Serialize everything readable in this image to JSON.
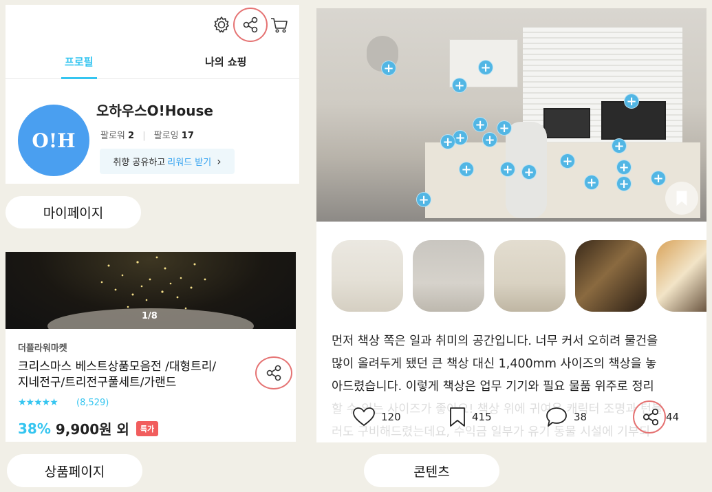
{
  "profile": {
    "tabs": [
      "프로필",
      "나의 쇼핑"
    ],
    "avatar_text": "O!H",
    "name": "오하우스O!House",
    "followers_label": "팔로워",
    "followers_count": "2",
    "following_label": "팔로잉",
    "following_count": "17",
    "reward_prefix": "취향 공유하고",
    "reward_link": "리워드 받기",
    "reward_chevron": "›",
    "icons": [
      "gear-icon",
      "share-icon",
      "cart-icon"
    ],
    "caption": "마이페이지"
  },
  "product": {
    "counter": "1/8",
    "seller": "더플라워마켓",
    "title_line1": "크리스마스 베스트상품모음전 /대형트리/",
    "title_line2": "지네전구/트리전구풀세트/가랜드",
    "stars": "★★★★★",
    "review_count": "(8,529)",
    "discount": "38%",
    "price": "9,900원 외",
    "badge": "특가",
    "caption": "상품페이지"
  },
  "content": {
    "desc_line1": "먼저 책상 쪽은 일과 취미의 공간입니다. 너무 커서 오히려 물건을",
    "desc_line2": "많이 올려두게 됐던 큰 책상 대신 1,400mm 사이즈의 책상을 놓",
    "desc_line3": "아드렸습니다. 이렇게 책상은 업무 기기와 필요 물품 위주로 정리",
    "desc_line4": "할 수 있는 사이즈가 좋아요! 책상 위에 귀여운 캐릭터 조명과 턴블",
    "desc_line5": "러도 구비해드렸는데요, 수익금 일부가 유기 동물 시설에 기부되",
    "likes": "120",
    "bookmarks": "415",
    "comments": "38",
    "shares": "44",
    "caption": "콘텐츠"
  },
  "colors": {
    "accent": "#35c5f0",
    "highlight_circle": "#e57373",
    "background": "#f1efe7",
    "avatar": "#4a9ff0",
    "badge": "#f15d5d"
  }
}
